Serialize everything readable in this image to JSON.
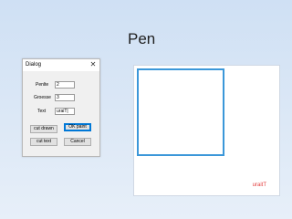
{
  "slide": {
    "title": "Pen"
  },
  "dialog": {
    "title": "Dialog",
    "close_icon": "close-icon",
    "fields": {
      "penlte_label": "Penlte",
      "penlte_value": "2",
      "groesse_label": "Groesse",
      "groesse_value": "3",
      "text_label": "Text",
      "text_value": "uraiT|"
    },
    "buttons": {
      "cut_drawn": "cut drawn",
      "ok_paint": "OK paint",
      "cut_text": "cut text",
      "cancel": "Cancel"
    }
  },
  "canvas": {
    "rect_color": "#3b97d9",
    "text": "uraitT",
    "text_color": "#e23b3b"
  }
}
